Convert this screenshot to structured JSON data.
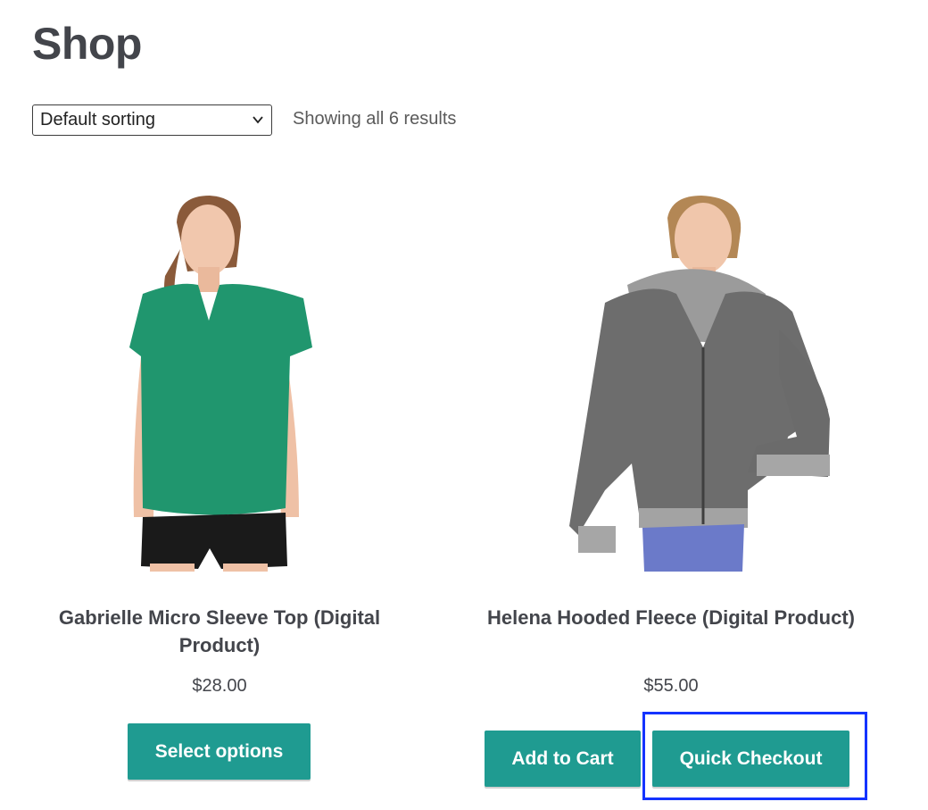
{
  "page": {
    "title": "Shop"
  },
  "toolbar": {
    "sort_selected": "Default sorting",
    "result_count": "Showing all 6 results"
  },
  "products": [
    {
      "title": "Gabrielle Micro Sleeve Top (Digital Product)",
      "price": "$28.00",
      "image_icon": "woman-green-tshirt-photo",
      "buttons": [
        "Select options"
      ]
    },
    {
      "title": "Helena Hooded Fleece (Digital Product)",
      "price": "$55.00",
      "image_icon": "woman-gray-hoodie-photo",
      "buttons": [
        "Add to Cart",
        "Quick Checkout"
      ]
    }
  ],
  "colors": {
    "button_bg": "#1f9b91",
    "highlight": "#1433ff",
    "text": "#43454b"
  }
}
